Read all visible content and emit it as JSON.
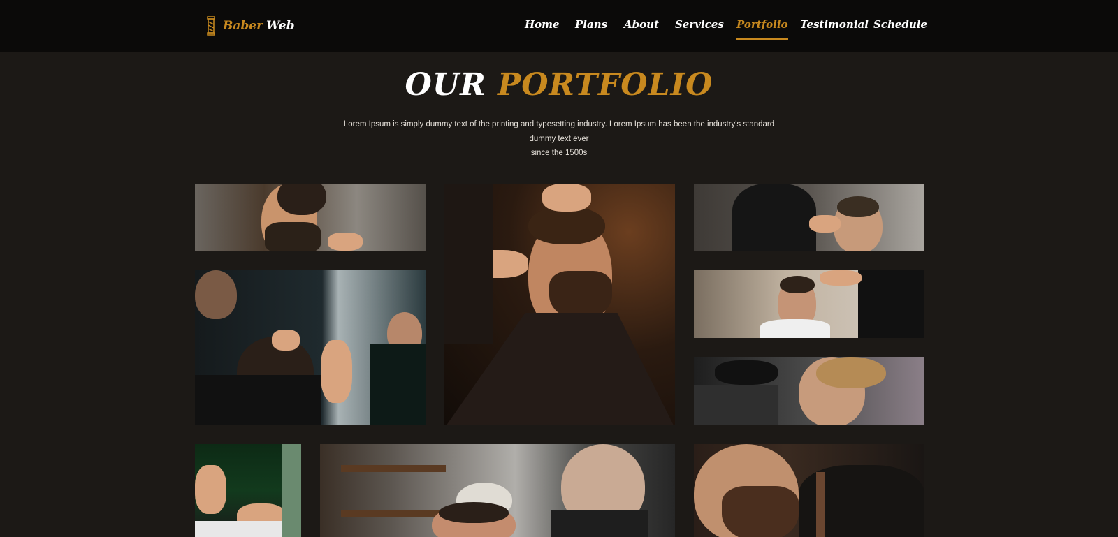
{
  "brand": {
    "name_part1": "Baber",
    "name_part2": "Web",
    "icon": "barber-pole-icon"
  },
  "nav": {
    "items": [
      {
        "label": "Home"
      },
      {
        "label": "Plans"
      },
      {
        "label": "About"
      },
      {
        "label": "Services"
      },
      {
        "label": "Portfolio",
        "active": true
      },
      {
        "label": "Testimonial"
      },
      {
        "label": "Schedule"
      }
    ]
  },
  "portfolio": {
    "title_part1": "OUR",
    "title_part2": "PORTFOLIO",
    "description_line1": "Lorem Ipsum is simply dummy text of the printing and typesetting industry. Lorem Ipsum has been the industry's standard dummy text ever",
    "description_line2": "since the 1500s"
  },
  "colors": {
    "accent": "#c8891f",
    "navbar_bg": "#0b0a09",
    "page_bg": "#1c1916",
    "text": "#ffffff"
  }
}
